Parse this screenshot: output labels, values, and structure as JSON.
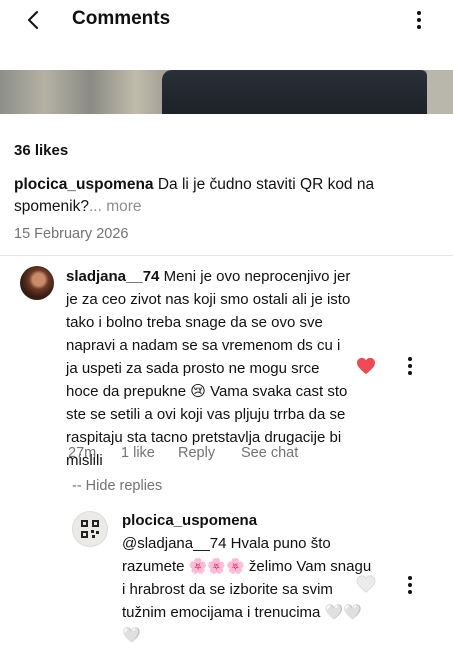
{
  "header": {
    "title": "Comments"
  },
  "post": {
    "likes": "36 likes",
    "caption_user": "plocica_uspomena",
    "caption_text": "Da li je čudno staviti QR kod na spomenik?",
    "caption_more": "... more",
    "date": "15 February 2026"
  },
  "comments": [
    {
      "username": "sladjana__74",
      "text": "Meni je ovo neprocenjivo jer je za ceo zivot nas koji smo ostali ali je isto tako i bolno treba snage da se ovo sve napravi a nadam se sa vremenom ds cu i ja uspeti za sada prosto ne mogu srce hoce da prepukne 😢 Vama svaka cast sto ste se setili a ovi koji vas pljuju trrba da se raspitaju sta tacno pretstavlja drugacije bi mislili",
      "time": "27m",
      "likes": "1 like",
      "reply": "Reply",
      "see_chat": "See chat",
      "liked": true
    }
  ],
  "hide_replies": "-- Hide replies",
  "reply": {
    "username": "plocica_uspomena",
    "text": "@sladjana__74 Hvala puno što razumete 🌸🌸🌸 želimo Vam snagu i hrabrost da se izborite sa svim tužnim emocijama i trenucima 🤍🤍🤍",
    "liked": false
  },
  "colors": {
    "heart_active": "#ed4956",
    "heart_inactive": "#d9d9d9",
    "meta_text": "#737373"
  }
}
